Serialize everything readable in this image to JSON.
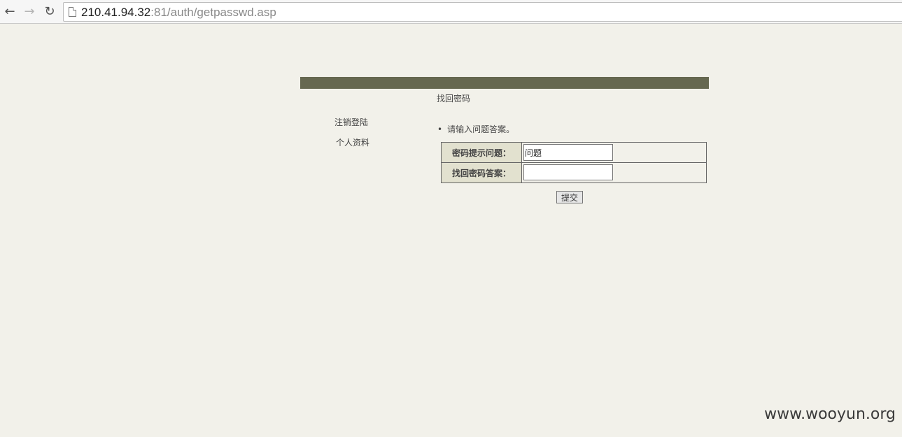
{
  "browser": {
    "url_host": "210.41.94.32",
    "url_rest": ":81/auth/getpasswd.asp"
  },
  "page": {
    "title": "找回密码",
    "sidebar": {
      "logout_label": "注销登陆",
      "profile_label": "个人资料"
    },
    "instruction_bullet": "•",
    "instruction": "请输入问题答案。",
    "form": {
      "question_label": "密码提示问题：",
      "question_value": "问题",
      "answer_label": "找回密码答案：",
      "answer_value": ""
    },
    "submit_label": "提交"
  },
  "watermark": "www.wooyun.org"
}
